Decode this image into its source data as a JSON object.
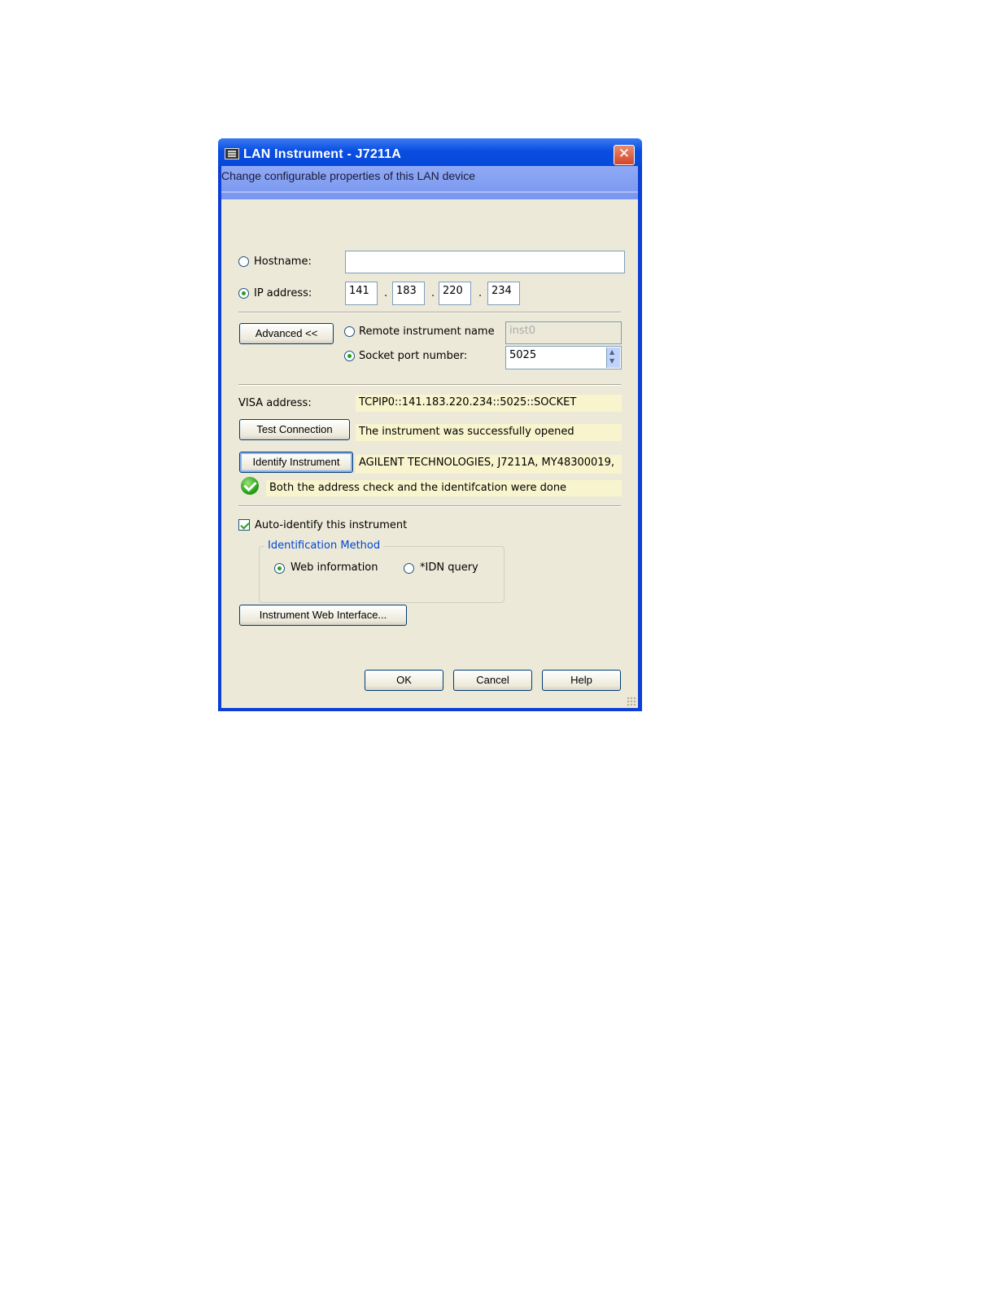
{
  "window": {
    "title": "LAN Instrument - J7211A",
    "subtitle": "Change configurable properties of this LAN device",
    "close_symbol": "✕"
  },
  "address": {
    "hostname_label": "Hostname:",
    "hostname_value": "",
    "hostname_selected": false,
    "ip_label": "IP address:",
    "ip_selected": true,
    "ip_octets": [
      "141",
      "183",
      "220",
      "234"
    ],
    "dot": "."
  },
  "advanced": {
    "button_label": "Advanced <<",
    "remote_name_label": "Remote instrument name",
    "remote_name_value": "inst0",
    "remote_name_selected": false,
    "socket_label": "Socket port number:",
    "socket_value": "5025",
    "socket_selected": true
  },
  "visa": {
    "label": "VISA address:",
    "value": "TCPIP0::141.183.220.234::5025::SOCKET"
  },
  "test": {
    "button_label": "Test Connection",
    "result": "The instrument was successfully opened"
  },
  "identify": {
    "button_label": "Identify Instrument",
    "result": "AGILENT TECHNOLOGIES, J7211A, MY48300019,",
    "status": "Both the address check and the identifcation were done"
  },
  "auto_identify": {
    "label": "Auto-identify this instrument",
    "checked": true
  },
  "identification_method": {
    "title": "Identification Method",
    "web_label": "Web information",
    "web_selected": true,
    "idn_label": "*IDN query",
    "idn_selected": false
  },
  "web_interface_button": "Instrument Web Interface...",
  "footer": {
    "ok": "OK",
    "cancel": "Cancel",
    "help": "Help"
  },
  "colors": {
    "title_bar": "#0a4ee2",
    "dialog_body": "#ece9d8",
    "highlight_yellow": "#f8f4cd",
    "group_title": "#0046d5"
  }
}
